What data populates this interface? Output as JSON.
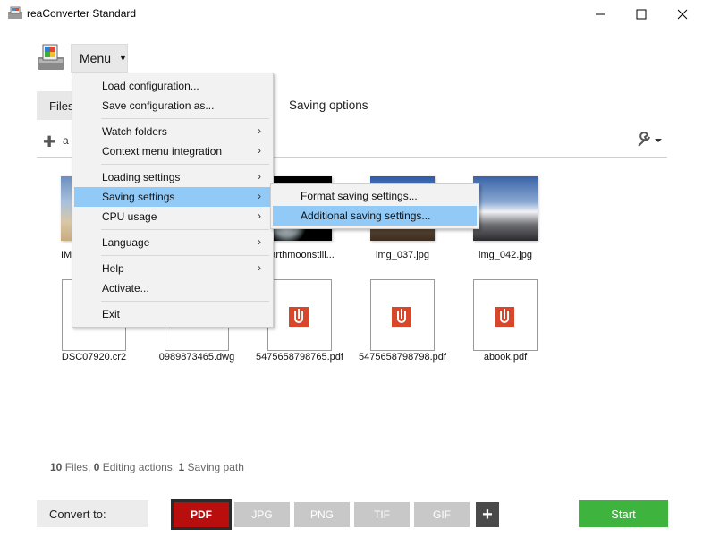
{
  "window": {
    "title": "reaConverter Standard"
  },
  "menu_button": {
    "label": "Menu"
  },
  "tabs": {
    "files": "Files",
    "saving_options": "Saving options"
  },
  "toolbar": {
    "add_label": "a"
  },
  "menu": {
    "items": [
      {
        "label": "Load configuration...",
        "submenu": false
      },
      {
        "label": "Save configuration as...",
        "submenu": false
      },
      {
        "label": "Watch folders",
        "submenu": true
      },
      {
        "label": "Context menu integration",
        "submenu": true
      },
      {
        "label": "Loading settings",
        "submenu": true
      },
      {
        "label": "Saving settings",
        "submenu": true,
        "highlighted": true
      },
      {
        "label": "CPU usage",
        "submenu": true
      },
      {
        "label": "Language",
        "submenu": true
      },
      {
        "label": "Help",
        "submenu": true
      },
      {
        "label": "Activate...",
        "submenu": false
      },
      {
        "label": "Exit",
        "submenu": false
      }
    ]
  },
  "submenu": {
    "items": [
      {
        "label": "Format saving settings..."
      },
      {
        "label": "Additional saving settings...",
        "highlighted": true
      }
    ]
  },
  "files": {
    "row1": [
      {
        "name": "IM"
      },
      {
        "name": ""
      },
      {
        "name": "earthmoonstill..."
      },
      {
        "name": "img_037.jpg"
      },
      {
        "name": "img_042.jpg"
      }
    ],
    "row2": [
      {
        "name": "DSC07920.cr2"
      },
      {
        "name": "0989873465.dwg"
      },
      {
        "name": "5475658798765.pdf"
      },
      {
        "name": "5475658798798.pdf"
      },
      {
        "name": "abook.pdf"
      }
    ]
  },
  "status": {
    "files_count": "10",
    "files_label": "Files,",
    "actions_count": "0",
    "actions_label": "Editing actions,",
    "paths_count": "1",
    "paths_label": "Saving path"
  },
  "convert": {
    "label": "Convert to:",
    "formats": [
      "PDF",
      "JPG",
      "PNG",
      "TIF",
      "GIF"
    ],
    "add": "+",
    "start": "Start"
  },
  "colors": {
    "accent_red": "#b80e0e",
    "start_green": "#3eb33e",
    "highlight": "#91c9f7"
  }
}
